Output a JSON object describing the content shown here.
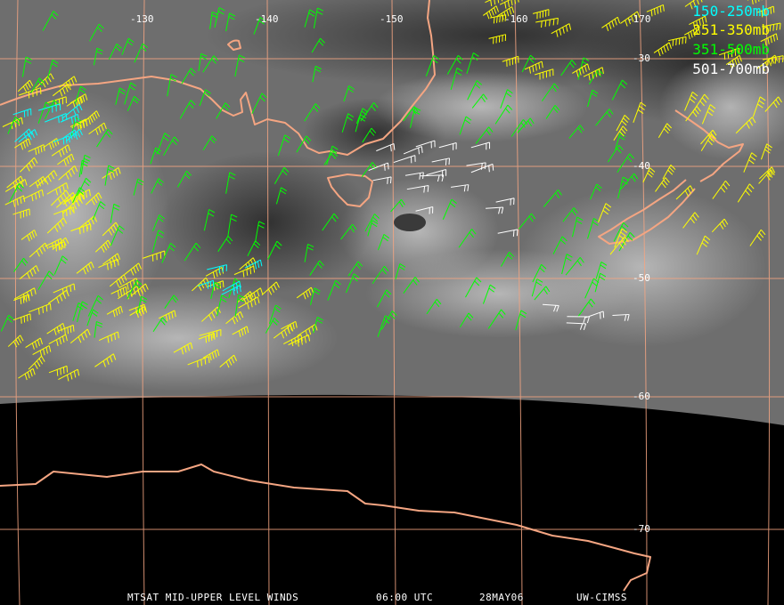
{
  "longitude_labels": [
    "-130",
    "-140",
    "-150",
    "-160",
    "-170"
  ],
  "latitude_labels": [
    "-30",
    "-40",
    "-50",
    "-60",
    "-70"
  ],
  "legend": [
    {
      "label": "150-250mb",
      "color": "#00ffff"
    },
    {
      "label": "251-350mb",
      "color": "#ffff00"
    },
    {
      "label": "351-500mb",
      "color": "#00ff00"
    },
    {
      "label": "501-700mb",
      "color": "#ffffff"
    }
  ],
  "footer": {
    "product": "MTSAT MID-UPPER LEVEL WINDS",
    "time": "06:00 UTC",
    "date": "28MAY06",
    "source": "UW-CIMSS"
  },
  "colors": {
    "coastline": "#f4a582",
    "gridline": "#f4a582",
    "background": "#000000"
  },
  "map_content": {
    "imagery": "water-vapor grayscale",
    "features": [
      "Australia",
      "Tasmania",
      "New Zealand",
      "Antarctica"
    ]
  }
}
